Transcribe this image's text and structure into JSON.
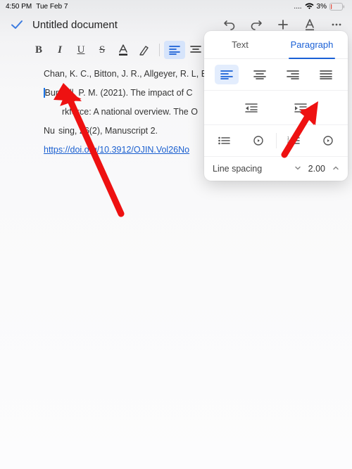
{
  "status": {
    "time": "4:50 PM",
    "date": "Tue Feb 7",
    "signal": "....",
    "battery": "3%"
  },
  "header": {
    "title": "Untitled document"
  },
  "toolbar": {
    "bold": "B",
    "italic": "I",
    "underline": "U",
    "strike": "S",
    "textcolor": "A"
  },
  "doc": {
    "l1": "Chan, K. C., Bitton, J. R., Allgeyer, R. L, Elli",
    "l2a": "Burwell, P. M. (2021). The impact of C",
    "l3": "rkforce: A national overview. The O",
    "l4": "Nu",
    "l4b": "sing, 26(2), Manuscript 2.",
    "link": "https://doi.org/10.3912/OJIN.Vol26No"
  },
  "panel": {
    "tab_text": "Text",
    "tab_para": "Paragraph",
    "line_spacing_label": "Line spacing",
    "line_spacing_value": "2.00"
  }
}
